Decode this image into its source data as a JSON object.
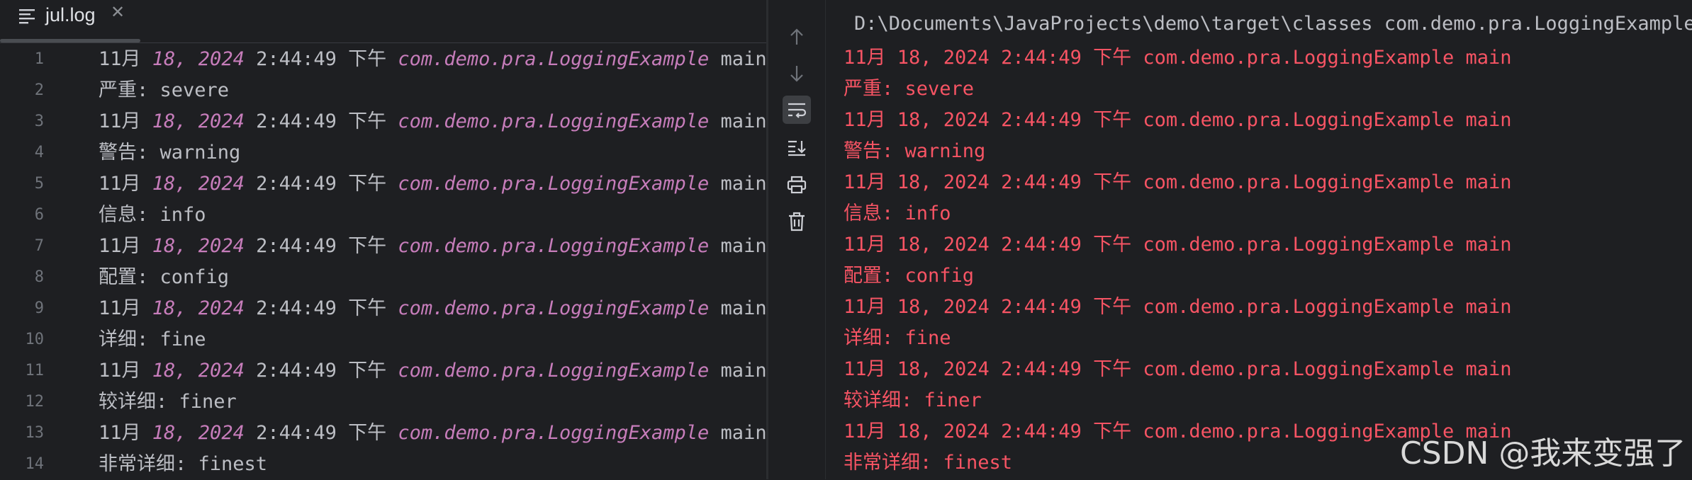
{
  "editor": {
    "tab_title": "jul.log",
    "close_glyph": "✕",
    "tab_icon": "text-lines-icon",
    "lines": [
      {
        "n": "1",
        "type": "header",
        "month": "11月 ",
        "day": "18, 2024",
        "time": " 2:44:49 下午 ",
        "cls": "com.demo.pra.LoggingExample",
        "method": " main"
      },
      {
        "n": "2",
        "type": "msg",
        "text": "严重: severe"
      },
      {
        "n": "3",
        "type": "header",
        "month": "11月 ",
        "day": "18, 2024",
        "time": " 2:44:49 下午 ",
        "cls": "com.demo.pra.LoggingExample",
        "method": " main"
      },
      {
        "n": "4",
        "type": "msg",
        "text": "警告: warning"
      },
      {
        "n": "5",
        "type": "header",
        "month": "11月 ",
        "day": "18, 2024",
        "time": " 2:44:49 下午 ",
        "cls": "com.demo.pra.LoggingExample",
        "method": " main"
      },
      {
        "n": "6",
        "type": "msg",
        "text": "信息: info"
      },
      {
        "n": "7",
        "type": "header",
        "month": "11月 ",
        "day": "18, 2024",
        "time": " 2:44:49 下午 ",
        "cls": "com.demo.pra.LoggingExample",
        "method": " main"
      },
      {
        "n": "8",
        "type": "msg",
        "text": "配置: config"
      },
      {
        "n": "9",
        "type": "header",
        "month": "11月 ",
        "day": "18, 2024",
        "time": " 2:44:49 下午 ",
        "cls": "com.demo.pra.LoggingExample",
        "method": " main"
      },
      {
        "n": "10",
        "type": "msg",
        "text": "详细: fine"
      },
      {
        "n": "11",
        "type": "header",
        "month": "11月 ",
        "day": "18, 2024",
        "time": " 2:44:49 下午 ",
        "cls": "com.demo.pra.LoggingExample",
        "method": " main"
      },
      {
        "n": "12",
        "type": "msg",
        "text": "较详细: finer"
      },
      {
        "n": "13",
        "type": "header",
        "month": "11月 ",
        "day": "18, 2024",
        "time": " 2:44:49 下午 ",
        "cls": "com.demo.pra.LoggingExample",
        "method": " main"
      },
      {
        "n": "14",
        "type": "msg",
        "text": "非常详细: finest"
      }
    ]
  },
  "toolstrip": {
    "tools": [
      "arrow-up-icon",
      "arrow-down-icon",
      "soft-wrap-icon",
      "scroll-to-end-icon",
      "print-icon",
      "trash-icon"
    ]
  },
  "console": {
    "command": "D:\\Documents\\JavaProjects\\demo\\target\\classes com.demo.pra.LoggingExample",
    "lines": [
      "11月 18, 2024 2:44:49 下午 com.demo.pra.LoggingExample main",
      "严重: severe",
      "11月 18, 2024 2:44:49 下午 com.demo.pra.LoggingExample main",
      "警告: warning",
      "11月 18, 2024 2:44:49 下午 com.demo.pra.LoggingExample main",
      "信息: info",
      "11月 18, 2024 2:44:49 下午 com.demo.pra.LoggingExample main",
      "配置: config",
      "11月 18, 2024 2:44:49 下午 com.demo.pra.LoggingExample main",
      "详细: fine",
      "11月 18, 2024 2:44:49 下午 com.demo.pra.LoggingExample main",
      "较详细: finer",
      "11月 18, 2024 2:44:49 下午 com.demo.pra.LoggingExample main",
      "非常详细: finest"
    ],
    "error_color": "#f75464"
  },
  "watermark": "CSDN @我来变强了",
  "colors": {
    "background": "#1e1f22",
    "text": "#bcbec4",
    "italic_purple": "#c77dbb",
    "line_number": "#6f737a"
  }
}
